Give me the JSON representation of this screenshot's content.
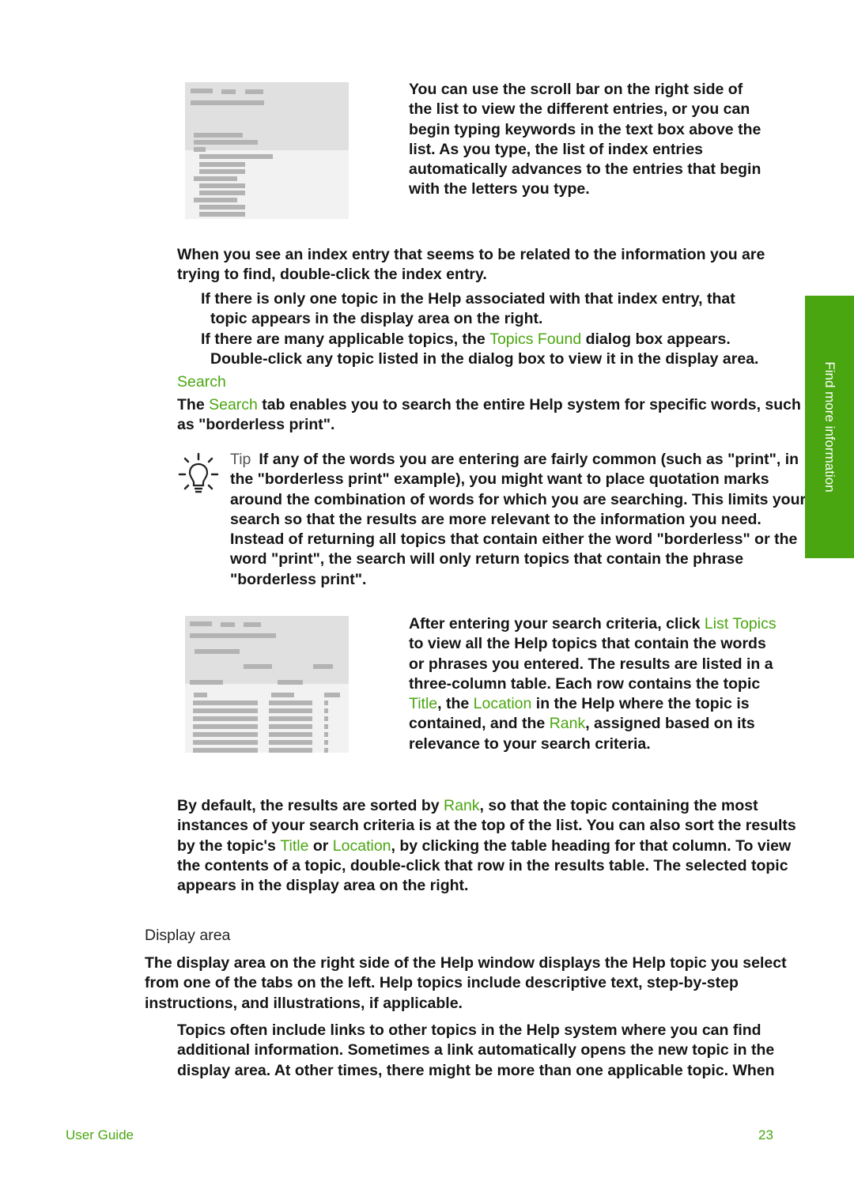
{
  "side_tab": {
    "label": "Find more information"
  },
  "index_section": {
    "scroll_paragraph": "You can use the scroll bar on the right side of the list to view the different entries, or you can begin typing keywords in the text box above the list. As you type, the list of index entries automatically advances to the entries that begin with the letters you type.",
    "scroll_lines": [
      "You can use the scroll bar on the right side of",
      "the list to view the different entries, or you can",
      "begin typing keywords in the text box above the",
      "list. As you type, the list of index entries",
      "automatically advances to the entries that begin",
      "with the letters you type."
    ],
    "double_click_paragraph": "When you see an index entry that seems to be related to the information you are trying to find, double-click the index entry.",
    "bullet1_a": "If there is only one topic in the Help associated with that index entry, that",
    "bullet1_b": "topic appears in the display area on the right.",
    "bullet2_pre": "If there are many applicable topics, the ",
    "bullet2_link": "Topics Found",
    "bullet2_post": " dialog box appears.",
    "bullet2_b": "Double-click any topic listed in the dialog box to view it in the display area."
  },
  "search_section": {
    "heading": "Search",
    "intro_pre": "The ",
    "intro_link": "Search",
    "intro_post": " tab enables you to search the entire Help system for specific words, such as \"borderless print\".",
    "tip_label": "Tip",
    "tip_text": "If any of the words you are entering are fairly common (such as \"print\", in the \"borderless print\" example), you might want to place quotation marks around the combination of words for which you are searching. This limits your search so that the results are more relevant to the information you need. Instead of returning all topics that contain either the word \"borderless\" or the word \"print\", the search will only return topics that contain the phrase \"borderless print\".",
    "results_p1": "After entering your search criteria, click ",
    "results_link_list_topics": "List Topics",
    "results_p2": " to view all the Help topics that contain the words or phrases you entered. The results are listed in a three-column table. Each row contains the topic ",
    "results_link_title": "Title",
    "results_p3": ", the ",
    "results_link_location": "Location",
    "results_p4": " in the Help where the topic is contained, and the ",
    "results_link_rank": "Rank",
    "results_p5": ", assigned based on its relevance to your search criteria.",
    "sort_p1": "By default, the results are sorted by ",
    "sort_link_rank": "Rank",
    "sort_p2": ", so that the topic containing the most instances of your search criteria is at the top of the list. You can also sort the results by the topic's ",
    "sort_link_title": "Title",
    "sort_p3": " or ",
    "sort_link_location": "Location",
    "sort_p4": ", by clicking the table heading for that column. To view the contents of a topic, double-click that row in the results table. The selected topic appears in the display area on the right."
  },
  "display_section": {
    "heading": "Display area",
    "p1": "The display area on the right side of the Help window displays the Help topic you select from one of the tabs on the left. Help topics include descriptive text, step-by-step instructions, and illustrations, if applicable.",
    "p2": "Topics often include links to other topics in the Help system where you can find additional information. Sometimes a link automatically opens the new topic in the display area. At other times, there might be more than one applicable topic. When"
  },
  "footer": {
    "left": "User Guide",
    "page_number": "23"
  },
  "colors": {
    "accent": "#4aa610",
    "text": "#151515"
  }
}
